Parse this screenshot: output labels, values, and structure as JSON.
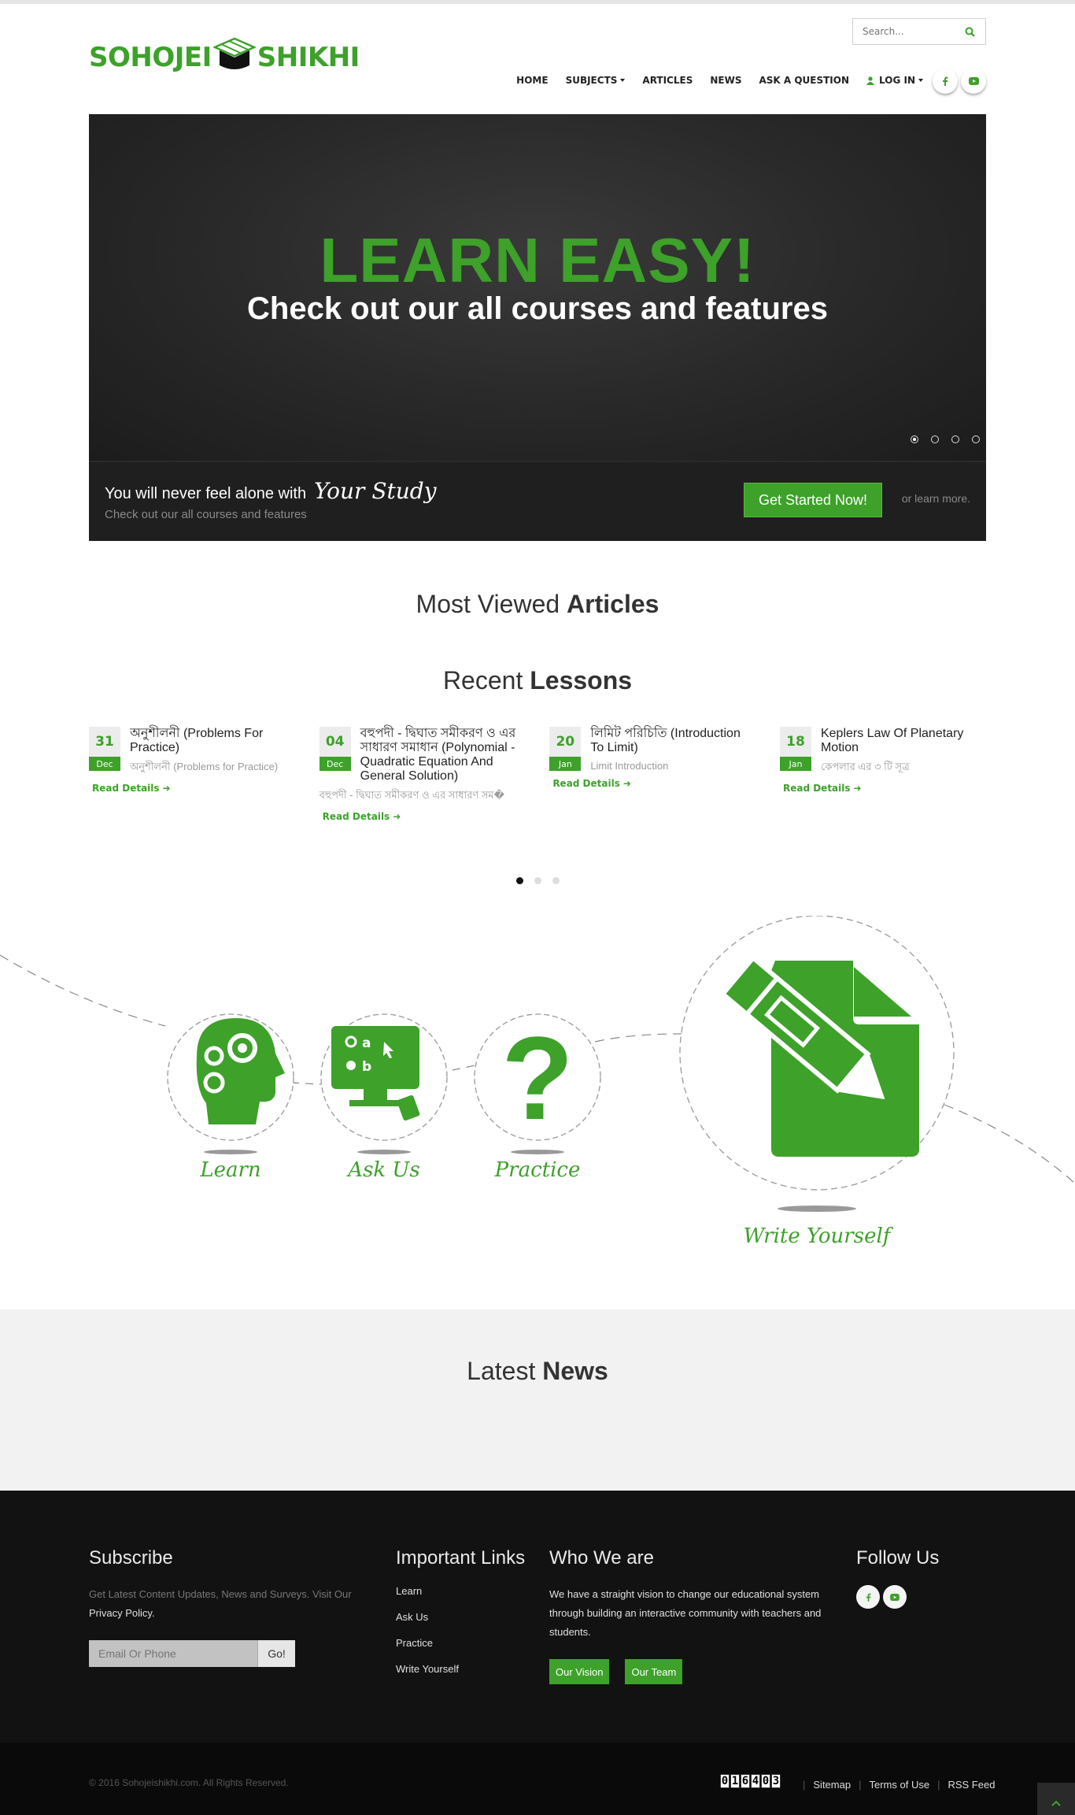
{
  "header": {
    "logo_left": "SOHOJEI",
    "logo_right": "SHIKHI",
    "search_placeholder": "Search...",
    "nav": [
      {
        "label": "HOME"
      },
      {
        "label": "SUBJECTS"
      },
      {
        "label": "ARTICLES"
      },
      {
        "label": "NEWS"
      },
      {
        "label": "ASK A QUESTION"
      },
      {
        "label": "LOG IN"
      }
    ],
    "social_icons": [
      "facebook-icon",
      "youtube-icon"
    ]
  },
  "hero": {
    "headline": "LEARN EASY!",
    "subheadline": "Check out our all courses and features",
    "tagline_prefix": "You will never feel alone with",
    "tagline_script": "Your Study",
    "tagline_sub": "Check out our all courses and features",
    "cta_label": "Get Started Now!",
    "learn_more": "or learn more.",
    "slide_count": 4,
    "active_slide": 1
  },
  "most_viewed": {
    "light": "Most Viewed",
    "bold": "Articles"
  },
  "recent": {
    "light": "Recent",
    "bold": "Lessons"
  },
  "lessons": [
    {
      "day": "31",
      "month": "Dec",
      "title": "অনুশীলনী (Problems For Practice)",
      "subtitle": "অনুশীলনী (Problems for Practice)",
      "read": "Read Details"
    },
    {
      "day": "04",
      "month": "Dec",
      "title": "বহুপদী - দ্বিঘাত সমীকরণ ও এর সাধারণ সমাধান (Polynomial - Quadratic Equation And General Solution)",
      "subtitle": "বহুপদী - দ্বিঘাত সমীকরণ ও এর সাধারণ সম�",
      "read": "Read Details"
    },
    {
      "day": "20",
      "month": "Jan",
      "title": "লিমিট পরিচিতি (Introduction To Limit)",
      "subtitle": "Limit Introduction",
      "read": "Read Details"
    },
    {
      "day": "18",
      "month": "Jan",
      "title": "Keplers Law Of Planetary Motion",
      "subtitle": "কেপলার এর ৩ টি সূত্র",
      "read": "Read Details"
    }
  ],
  "lessons_pager": {
    "pages": 3,
    "active": 1
  },
  "features": [
    {
      "label": "Learn",
      "icon": "brain-gears-icon"
    },
    {
      "label": "Ask Us",
      "icon": "monitor-quiz-icon"
    },
    {
      "label": "Practice",
      "icon": "question-mark-icon"
    },
    {
      "label": "Write Yourself",
      "icon": "pencil-paper-icon"
    }
  ],
  "latest_news": {
    "light": "Latest",
    "bold": "News"
  },
  "footer": {
    "subscribe_title": "Subscribe",
    "subscribe_text": "Get Latest Content Updates, News and Surveys. Visit Our",
    "privacy": "Privacy Policy.",
    "email_placeholder": "Email Or Phone",
    "go": "Go!",
    "links_title": "Important Links",
    "links": [
      "Learn",
      "Ask Us",
      "Practice",
      "Write Yourself"
    ],
    "who_title": "Who We are",
    "who_text": "We have a straight vision to change our educational system through building an interactive community with teachers and students.",
    "vision_btn": "Our Vision",
    "team_btn": "Our Team",
    "follow_title": "Follow Us"
  },
  "bottom": {
    "copyright": "© 2016 Sohojeishikhi.com. All Rights Reserved.",
    "counter": [
      "0",
      "1",
      "6",
      "4",
      "0",
      "3"
    ],
    "links": [
      "Sitemap",
      "Terms of Use",
      "RSS Feed"
    ]
  },
  "colors": {
    "brand_green": "#3da12a",
    "footer_bg": "#121212",
    "hero_bg": "#2b2b2b"
  }
}
